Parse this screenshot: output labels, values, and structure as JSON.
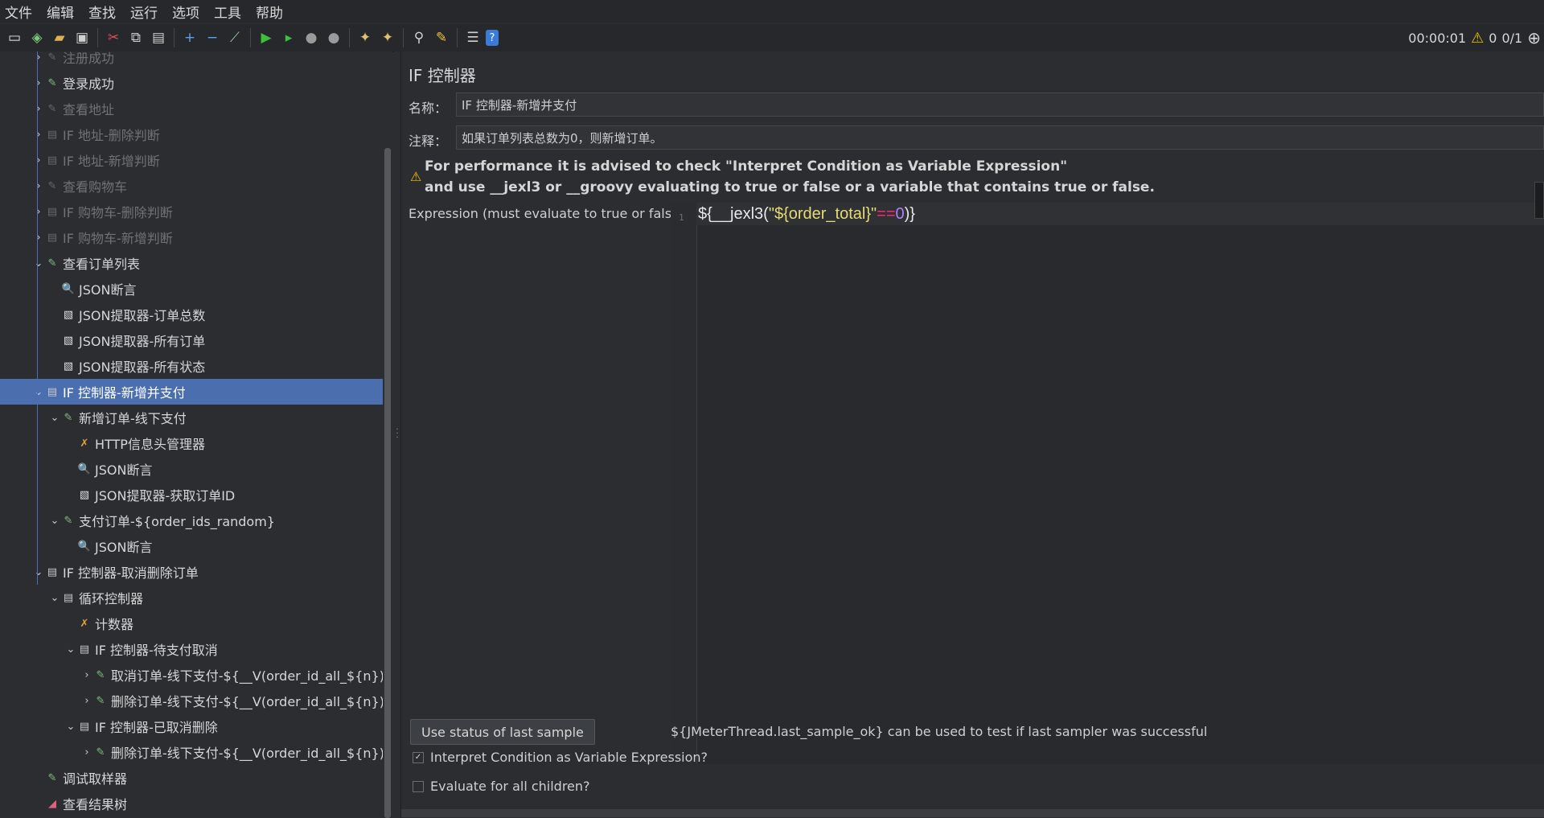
{
  "menu": [
    "文件",
    "编辑",
    "查找",
    "运行",
    "选项",
    "工具",
    "帮助"
  ],
  "toolbar": {
    "timer": "00:00:01",
    "warnings": "0",
    "threads": "0/1",
    "icons": [
      "new-icon",
      "templates-icon",
      "open-icon",
      "save-icon",
      "cut-icon",
      "copy-icon",
      "paste-icon",
      "expand-icon",
      "collapse-icon",
      "toggle-icon",
      "start-icon",
      "start-no-pause-icon",
      "stop-icon",
      "shutdown-icon",
      "clear-icon",
      "clear-all-icon",
      "search-icon",
      "reset-search-icon",
      "function-helper-icon",
      "help-icon"
    ]
  },
  "tree": [
    {
      "label": "注册成功",
      "icon": "sampler",
      "dim": true,
      "arrow": "right"
    },
    {
      "label": "登录成功",
      "icon": "sampler",
      "dim": false,
      "arrow": "right"
    },
    {
      "label": "查看地址",
      "icon": "sampler",
      "dim": true,
      "arrow": "right"
    },
    {
      "label": "IF 地址-删除判断",
      "icon": "controller",
      "dim": true,
      "arrow": "right"
    },
    {
      "label": "IF 地址-新增判断",
      "icon": "controller",
      "dim": true,
      "arrow": "right"
    },
    {
      "label": "查看购物车",
      "icon": "sampler",
      "dim": true,
      "arrow": "right"
    },
    {
      "label": "IF 购物车-删除判断",
      "icon": "controller",
      "dim": true,
      "arrow": "right"
    },
    {
      "label": "IF 购物车-新增判断",
      "icon": "controller",
      "dim": true,
      "arrow": "right"
    },
    {
      "label": "查看订单列表",
      "icon": "sampler",
      "dim": false,
      "arrow": "down"
    },
    {
      "label": "JSON断言",
      "icon": "assertion",
      "dim": false,
      "arrow": ""
    },
    {
      "label": "JSON提取器-订单总数",
      "icon": "extractor",
      "dim": false,
      "arrow": ""
    },
    {
      "label": "JSON提取器-所有订单",
      "icon": "extractor",
      "dim": false,
      "arrow": ""
    },
    {
      "label": "JSON提取器-所有状态",
      "icon": "extractor",
      "dim": false,
      "arrow": ""
    },
    {
      "label": "IF 控制器-新增并支付",
      "icon": "controller",
      "dim": false,
      "arrow": "down",
      "selected": true
    },
    {
      "label": "新增订单-线下支付",
      "icon": "sampler",
      "dim": false,
      "arrow": "down"
    },
    {
      "label": "HTTP信息头管理器",
      "icon": "config",
      "dim": false,
      "arrow": ""
    },
    {
      "label": "JSON断言",
      "icon": "assertion",
      "dim": false,
      "arrow": ""
    },
    {
      "label": "JSON提取器-获取订单ID",
      "icon": "extractor",
      "dim": false,
      "arrow": ""
    },
    {
      "label": "支付订单-${order_ids_random}",
      "icon": "sampler",
      "dim": false,
      "arrow": "down"
    },
    {
      "label": "JSON断言",
      "icon": "assertion",
      "dim": false,
      "arrow": ""
    },
    {
      "label": "IF 控制器-取消删除订单",
      "icon": "controller",
      "dim": false,
      "arrow": "down"
    },
    {
      "label": "循环控制器",
      "icon": "controller",
      "dim": false,
      "arrow": "down"
    },
    {
      "label": "计数器",
      "icon": "config",
      "dim": false,
      "arrow": ""
    },
    {
      "label": "IF 控制器-待支付取消",
      "icon": "controller",
      "dim": false,
      "arrow": "down"
    },
    {
      "label": "取消订单-线下支付-${__V(order_id_all_${n})}",
      "icon": "sampler",
      "dim": false,
      "arrow": "right"
    },
    {
      "label": "删除订单-线下支付-${__V(order_id_all_${n})}",
      "icon": "sampler",
      "dim": false,
      "arrow": "right"
    },
    {
      "label": "IF 控制器-已取消删除",
      "icon": "controller",
      "dim": false,
      "arrow": "down"
    },
    {
      "label": "删除订单-线下支付-${__V(order_id_all_${n})}",
      "icon": "sampler",
      "dim": false,
      "arrow": "right"
    },
    {
      "label": "调试取样器",
      "icon": "sampler",
      "dim": false,
      "arrow": ""
    },
    {
      "label": "查看结果树",
      "icon": "listener",
      "dim": false,
      "arrow": ""
    }
  ],
  "panel": {
    "title": "IF 控制器",
    "name_label": "名称：",
    "name_value": "IF 控制器-新增并支付",
    "comment_label": "注释：",
    "comment_value": "如果订单列表总数为0，则新增订单。",
    "warning_line1": "For performance it is advised to check \"Interpret Condition as Variable Expression\"",
    "warning_line2": "and use __jexl3 or __groovy evaluating to true or false or a variable that contains true or false.",
    "expression_label": "Expression (must evaluate to true or false)",
    "line_number": "1",
    "code": {
      "p1": "${__jexl3(",
      "p2": "\"${order_total}\"",
      "p3": "==",
      "p4": "0",
      "p5": ")}"
    },
    "use_status_button": "Use status of last sample",
    "hint": "${JMeterThread.last_sample_ok} can be used to test if last sampler was successful",
    "interpret_label": "Interpret Condition as Variable Expression?",
    "interpret_checked": true,
    "evaluate_label": "Evaluate for all children?",
    "evaluate_checked": false
  },
  "colors": {
    "selection": "#4b6eaf",
    "background": "#2b2d30",
    "string": "#e6db74",
    "operator": "#f92672",
    "number": "#ae81ff"
  }
}
